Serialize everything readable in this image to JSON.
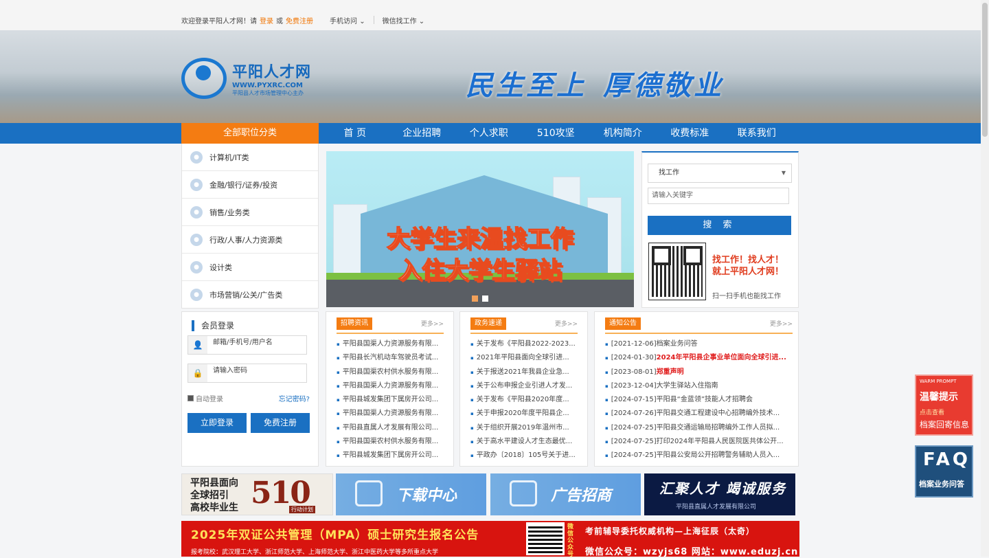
{
  "topbar": {
    "welcome": "欢迎登录平阳人才网！请",
    "login": "登录",
    "or": "或",
    "register": "免费注册",
    "mobile": "手机访问",
    "wechat": "微信找工作"
  },
  "logo": {
    "name": "平阳人才网",
    "url": "WWW.PYXRC.COM",
    "org": "平阳县人才市场管理中心主办"
  },
  "banner": {
    "slogan1": "民生至上",
    "slogan2": "厚德敬业"
  },
  "nav": {
    "all": "全部职位分类",
    "items": [
      "首 页",
      "企业招聘",
      "个人求职",
      "510攻坚",
      "机构简介",
      "收费标准",
      "联系我们"
    ]
  },
  "categories": [
    "计算机/IT类",
    "金融/银行/证券/投资",
    "销售/业务类",
    "行政/人事/人力资源类",
    "设计类",
    "市场营销/公关/广告类"
  ],
  "slider": {
    "line1": "大学生来温找工作",
    "line2": "入住大学生驿站"
  },
  "search": {
    "select": "找工作",
    "placeholder": "请输入关键字",
    "button": "搜 索",
    "slogan1": "找工作！找人才！",
    "slogan2": "就上平阳人才网！",
    "scan": "扫一扫手机也能找工作"
  },
  "login": {
    "title": "会员登录",
    "user_placeholder": "邮箱/手机号/用户名",
    "pwd_placeholder": "请输入密码",
    "auto": "自动登录",
    "forgot": "忘记密码?",
    "login_btn": "立即登录",
    "reg_btn": "免费注册"
  },
  "news": [
    {
      "tag": "招聘资讯",
      "more": "更多>>",
      "items": [
        "平阳县国渠人力资源服务有限...",
        "平阳县长汽机动车驾驶员考试...",
        "平阳县国渠农村供水服务有限...",
        "平阳县国渠人力资源服务有限...",
        "平阳县城发集团下属房开公司...",
        "平阳县国渠人力资源服务有限...",
        "平阳县直属人才发展有限公司...",
        "平阳县国渠农村供水服务有限...",
        "平阳县城发集团下属房开公司..."
      ]
    },
    {
      "tag": "政务速递",
      "more": "更多>>",
      "items": [
        "关于发布《平阳县2022-2023...",
        "2021年平阳县面向全球引进...",
        "关于报送2021年我县企业急...",
        "关于公布申报企业引进人才发...",
        "关于发布《平阳县2020年度...",
        "关于申报2020年度平阳县企...",
        "关于组织开展2019年温州市...",
        "关于高水平建设人才生态最优...",
        "平政办〔2018〕105号关于进..."
      ]
    }
  ],
  "notice": {
    "tag": "通知公告",
    "more": "更多>>",
    "items": [
      {
        "date": "[2021-12-06]",
        "text": "档案业务问答",
        "red": ""
      },
      {
        "date": "[2024-01-30]",
        "text": "",
        "red": "2024年平阳县企事业单位面向全球引进..."
      },
      {
        "date": "[2023-08-01]",
        "text": "",
        "red": "郑重声明"
      },
      {
        "date": "[2023-12-04]",
        "text": "大学生驿站入住指南",
        "red": ""
      },
      {
        "date": "[2024-07-15]",
        "text": "平阳县“金蓝领”技能人才招聘会",
        "red": ""
      },
      {
        "date": "[2024-07-26]",
        "text": "平阳县交通工程建设中心招聘编外技术...",
        "red": ""
      },
      {
        "date": "[2024-07-25]",
        "text": "平阳县交通运输局招聘编外工作人员拟...",
        "red": ""
      },
      {
        "date": "[2024-07-25]",
        "text": "打印2024年平阳县人民医院医共体公开...",
        "red": ""
      },
      {
        "date": "[2024-07-25]",
        "text": "平阳县公安局公开招聘警务辅助人员入...",
        "red": ""
      }
    ]
  },
  "ads": {
    "a1_line1": "平阳县面向",
    "a1_line2": "全球招引",
    "a1_line3": "高校毕业生",
    "a1_big": "510",
    "a1_plan": "行动计划",
    "a2": "下载中心",
    "a3": "广告招商",
    "a4": "汇聚人才  竭诚服务",
    "a4_sub": "平阳县直属人才发展有限公司"
  },
  "mpa": {
    "title": "2025年双证公共管理（MPA）硕士研究生报名公告",
    "schools": "报考院校：武汉理工大学、浙江师范大学、上海师范大学、浙江中医药大学等多所重点大学",
    "wx": "微信公众号",
    "r1": "考前辅导委托权威机构—上海征辰（太奇）",
    "r2": "微信公众号：wzyjs68   网站：www.eduzj.cn"
  },
  "float": {
    "warm_en": "WARM PROMPT",
    "warm": "温馨提示",
    "click": "点击查看",
    "archive": "档案回寄信息",
    "faq": "FAQ",
    "faq_sub": "档案业务问答"
  }
}
